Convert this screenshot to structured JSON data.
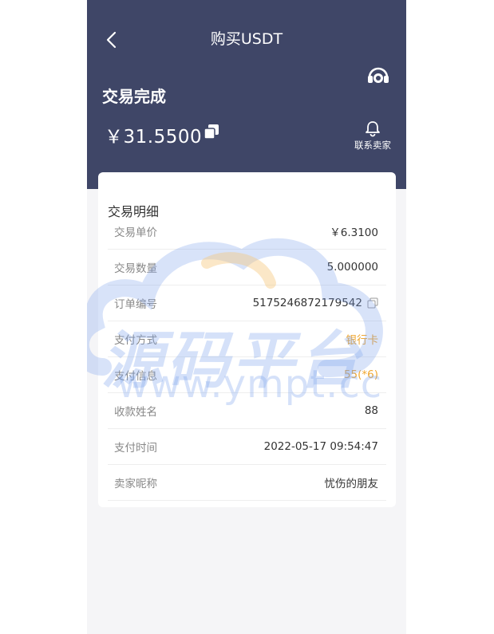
{
  "header": {
    "title": "购买USDT",
    "status": "交易完成",
    "amount": "￥31.5500",
    "contact_label": "联系卖家",
    "bg_color": "#3f4667"
  },
  "icons": {
    "back": "chevron-left-icon",
    "service": "headset-icon",
    "copy": "copy-icon",
    "bell": "bell-icon"
  },
  "details": {
    "title": "交易明细",
    "rows": [
      {
        "label": "交易单价",
        "value": "￥6.3100"
      },
      {
        "label": "交易数量",
        "value": "5.000000"
      },
      {
        "label": "订单编号",
        "value": "5175246872179542"
      },
      {
        "label": "支付方式",
        "value": "银行卡"
      },
      {
        "label": "支付信息",
        "value": "55(*6)"
      },
      {
        "label": "收款姓名",
        "value": "88"
      },
      {
        "label": "支付时间",
        "value": "2022-05-17 09:54:47"
      },
      {
        "label": "卖家昵称",
        "value": "忧伤的朋友"
      }
    ]
  },
  "watermark": {
    "cn": "源码平台",
    "en": "www.ympt.cc"
  },
  "colors": {
    "accent_orange": "#f0a731",
    "watermark_blue": "#78a0eb"
  }
}
